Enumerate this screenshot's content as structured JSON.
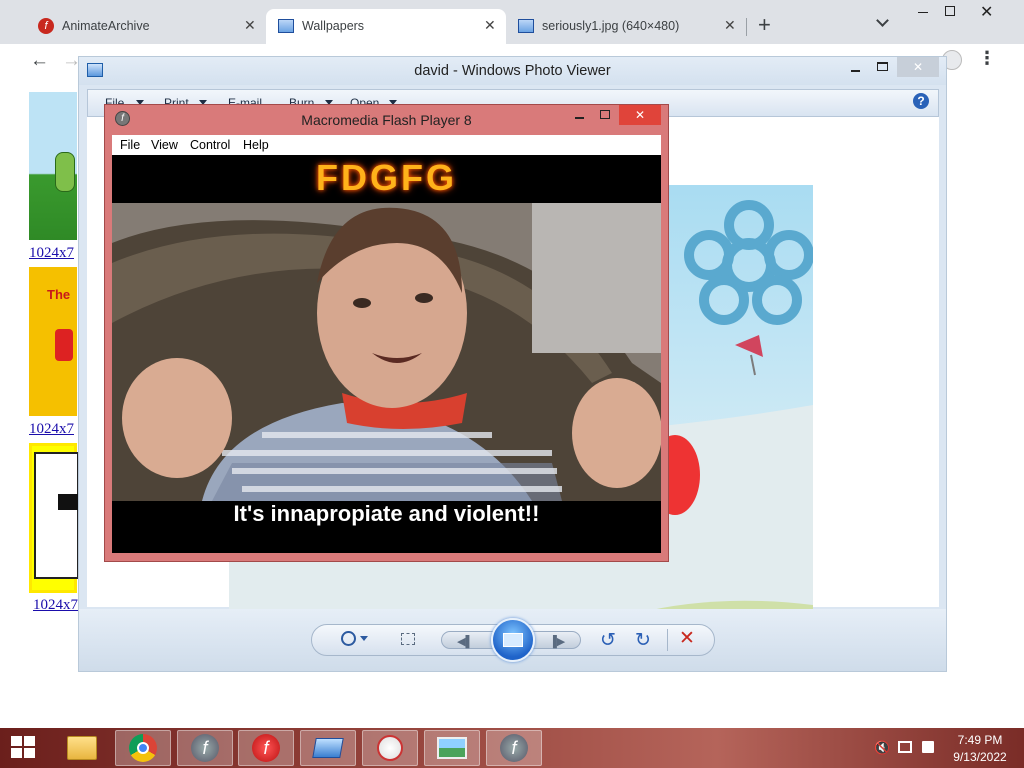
{
  "browser": {
    "tabs": [
      {
        "label": "AnimateArchive",
        "icon": "flash-icon"
      },
      {
        "label": "Wallpapers",
        "icon": "image-icon"
      },
      {
        "label": "seriously1.jpg (640×480)",
        "icon": "image-icon"
      }
    ],
    "new_tab_symbol": "+",
    "thumb_links": [
      "1024x7",
      "1024x7",
      "1024x7"
    ]
  },
  "photo_viewer": {
    "title": "david - Windows Photo Viewer",
    "menu": [
      "File",
      "Print",
      "E-mail",
      "Burn",
      "Open"
    ],
    "help_symbol": "?"
  },
  "flash_player": {
    "title": "Macromedia Flash Player 8",
    "menu": [
      "File",
      "View",
      "Control",
      "Help"
    ],
    "banner_text": "FDGFG",
    "caption": "It's innapropiate and violent!!"
  },
  "taskbar": {
    "time": "7:49 PM",
    "date": "9/13/2022"
  },
  "colors": {
    "flash_frame": "#d97a7a",
    "close_red": "#e0443a",
    "viewer_frame": "#dbe6f2"
  }
}
